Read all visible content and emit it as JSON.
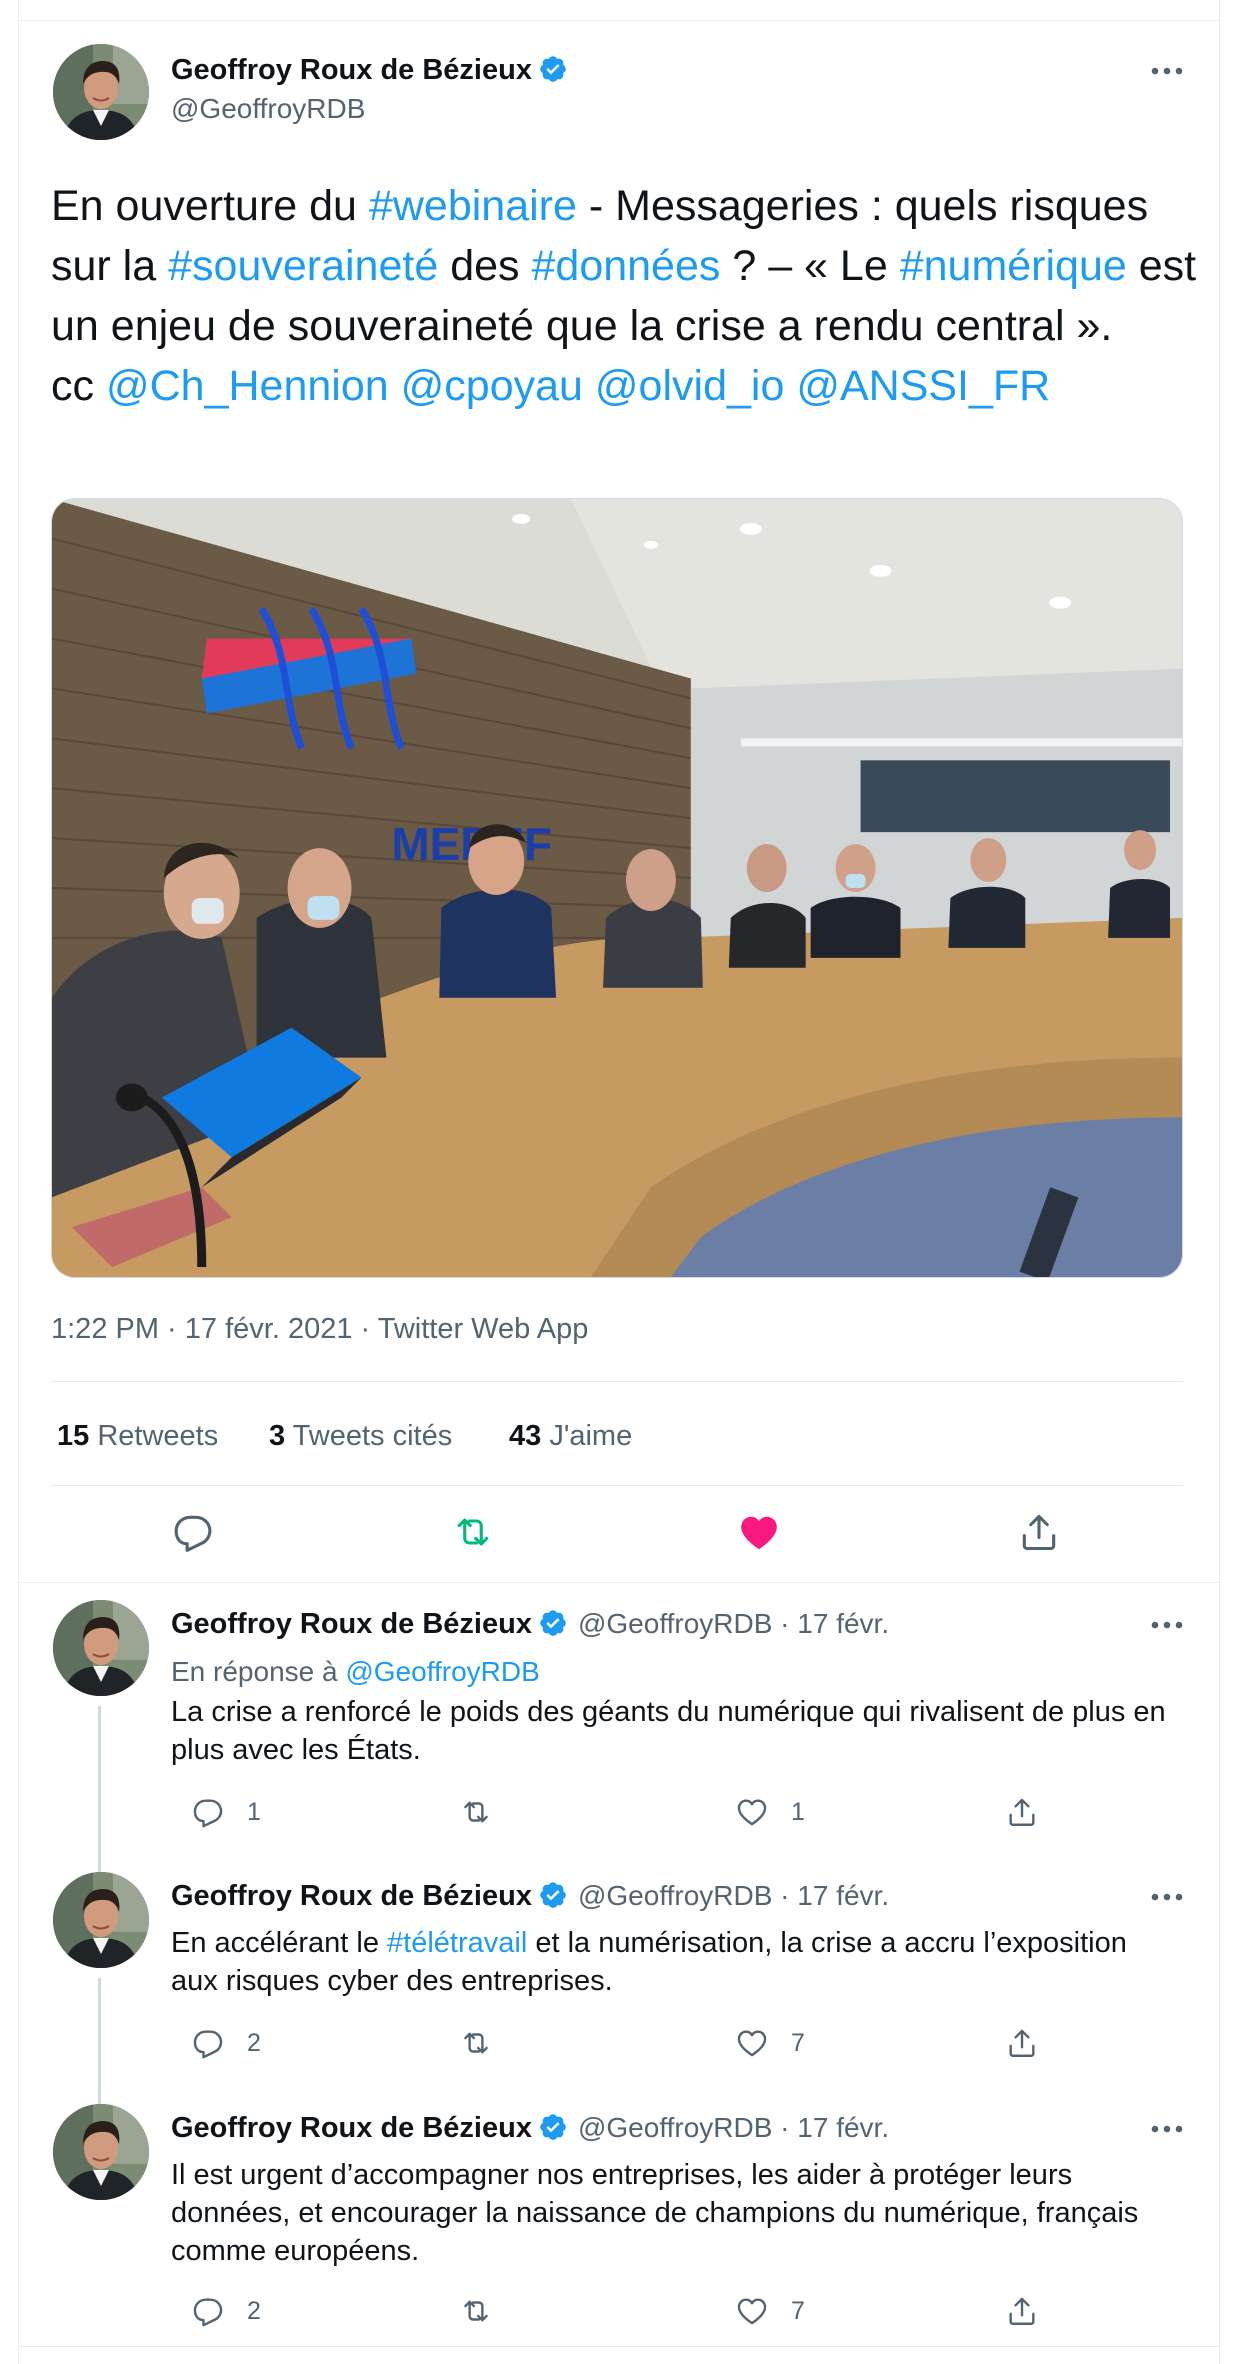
{
  "main_tweet": {
    "author_name": "Geoffroy Roux de Bézieux",
    "author_handle": "@GeoffroyRDB",
    "text": {
      "t1": "En ouverture du ",
      "tag_webinaire": "#webinaire",
      "t2": " - Messageries : quels risques sur la ",
      "tag_souverainete": "#souveraineté",
      "t3": " des ",
      "tag_donnees": "#données",
      "t4": " ? – « Le ",
      "tag_numerique": "#numérique",
      "t5": " est un enjeu de souveraineté que la crise a rendu central ».",
      "cc": "cc ",
      "mention1": "@Ch_Hennion",
      "mention2": "@cpoyau",
      "mention3": "@olvid_io",
      "mention4": "@ANSSI_FR"
    },
    "photo_sign": "MEDEF",
    "meta": "1:22 PM · 17 févr. 2021 · Twitter Web App",
    "stats": {
      "retweets_count": "15",
      "retweets_label": " Retweets",
      "quotes_count": "3",
      "quotes_label": " Tweets cités",
      "likes_count": "43",
      "likes_label": " J'aime"
    }
  },
  "replies": [
    {
      "author_name": "Geoffroy Roux de Bézieux",
      "author_handle": "@GeoffroyRDB",
      "date": " · 17 févr.",
      "reply_to_prefix": "En réponse à ",
      "reply_to_handle": "@GeoffroyRDB",
      "text": "La crise a renforcé le poids des géants du numérique qui rivalisent de plus en plus avec les États.",
      "replies": "1",
      "retweets": "",
      "likes": "1"
    },
    {
      "author_name": "Geoffroy Roux de Bézieux",
      "author_handle": "@GeoffroyRDB",
      "date": " · 17 févr.",
      "text_before": "En accélérant le ",
      "hashtag": "#télétravail",
      "text_after": " et la numérisation, la crise a accru l’exposition aux risques cyber des entreprises.",
      "replies": "2",
      "retweets": "",
      "likes": "7"
    },
    {
      "author_name": "Geoffroy Roux de Bézieux",
      "author_handle": "@GeoffroyRDB",
      "date": " · 17 févr.",
      "text": "Il est urgent d’accompagner nos entreprises, les aider à protéger leurs données, et encourager la naissance de champions du numérique, français comme européens.",
      "replies": "2",
      "retweets": "",
      "likes": "7"
    }
  ],
  "colors": {
    "link": "#1d9bf0",
    "retweet_active": "#00ba7c",
    "like_active": "#f91880",
    "secondary_text": "#536471"
  },
  "icons": [
    "verified-badge-icon",
    "more-options-icon",
    "reply-icon",
    "retweet-icon",
    "like-icon",
    "share-icon"
  ]
}
